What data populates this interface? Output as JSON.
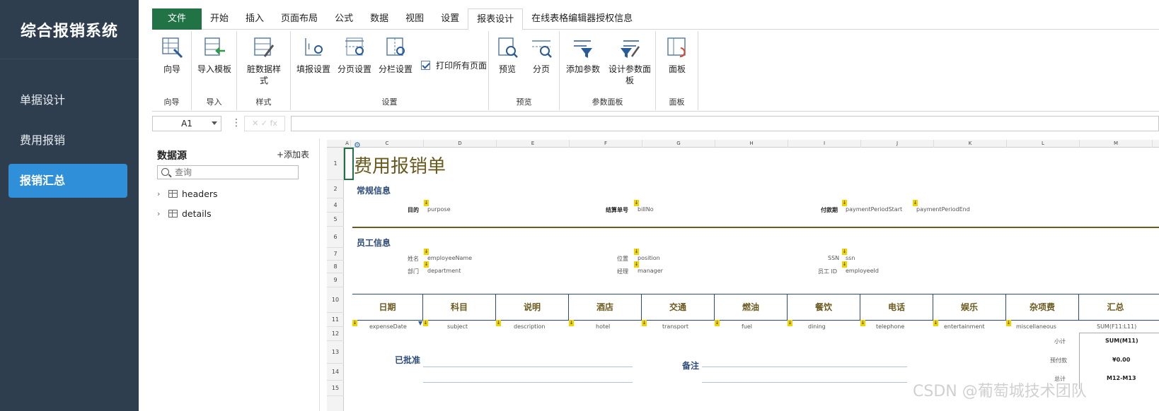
{
  "sidebar": {
    "title": "综合报销系统",
    "items": [
      {
        "label": "单据设计"
      },
      {
        "label": "费用报销"
      },
      {
        "label": "报销汇总",
        "active": true
      }
    ],
    "bg": "#2f3e4e",
    "active_color": "#2f8fd8"
  },
  "ribbon": {
    "tabs": [
      {
        "label": "文件"
      },
      {
        "label": "开始"
      },
      {
        "label": "插入"
      },
      {
        "label": "页面布局"
      },
      {
        "label": "公式"
      },
      {
        "label": "数据"
      },
      {
        "label": "视图"
      },
      {
        "label": "设置"
      },
      {
        "label": "报表设计"
      },
      {
        "label": "在线表格编辑器授权信息"
      }
    ],
    "buttons": {
      "wizard": "向导",
      "import_template": "导入模板",
      "dirty_style": "脏数据样式",
      "fill_settings": "填报设置",
      "paging_settings": "分页设置",
      "column_settings": "分栏设置",
      "print_all": "打印所有页面",
      "preview": "预览",
      "paging": "分页",
      "add_param": "添加参数",
      "design_param_panel": "设计参数面板",
      "panel": "面板"
    },
    "groups": {
      "wizard": "向导",
      "import": "导入",
      "style": "样式",
      "settings": "设置",
      "preview": "预览",
      "param_panel": "参数面板",
      "panel": "面板"
    }
  },
  "formula_bar": {
    "cell_ref": "A1",
    "value": ""
  },
  "datasource": {
    "title": "数据源",
    "add_table": "+添加表",
    "search_placeholder": "查询",
    "tables": [
      {
        "label": "headers"
      },
      {
        "label": "details"
      }
    ]
  },
  "sheet": {
    "columns": [
      "A",
      "C",
      "D",
      "E",
      "F",
      "G",
      "H",
      "I",
      "J",
      "K",
      "L",
      "M"
    ],
    "rows": [
      "1",
      "2",
      "4",
      "5",
      "6",
      "7",
      "8",
      "9",
      "10",
      "11",
      "12",
      "13",
      "14",
      "15"
    ],
    "title": "费用报销单",
    "sections": {
      "general": "常规信息",
      "employee": "员工信息"
    },
    "fields": {
      "purpose_label": "目的",
      "purpose": "purpose",
      "billno_label": "结算单号",
      "billno": "billNo",
      "period_label": "付款期",
      "period_start": "paymentPeriodStart",
      "period_end": "paymentPeriodEnd",
      "name_label": "姓名",
      "name": "employeeName",
      "position_label": "位置",
      "position": "position",
      "ssn_label": "SSN",
      "ssn": "ssn",
      "dept_label": "部门",
      "dept": "department",
      "manager_label": "经理",
      "manager": "manager",
      "empid_label": "员工 ID",
      "empid": "employeeId"
    },
    "headers": [
      "日期",
      "科目",
      "说明",
      "酒店",
      "交通",
      "燃油",
      "餐饮",
      "电话",
      "娱乐",
      "杂项费",
      "汇总"
    ],
    "detail_fields": [
      "expenseDate",
      "subject",
      "description",
      "hotel",
      "transport",
      "fuel",
      "dining",
      "telephone",
      "entertainment",
      "miscellaneous",
      "SUM(F11:L11)"
    ],
    "summary": {
      "subtotal_label": "小计",
      "subtotal": "SUM(M11)",
      "prepaid_label": "预付款",
      "prepaid": "¥0.00",
      "total_label": "总计",
      "total": "M12-M13"
    },
    "approved": "已批准",
    "remarks": "备注"
  },
  "watermark": "CSDN @葡萄城技术团队"
}
